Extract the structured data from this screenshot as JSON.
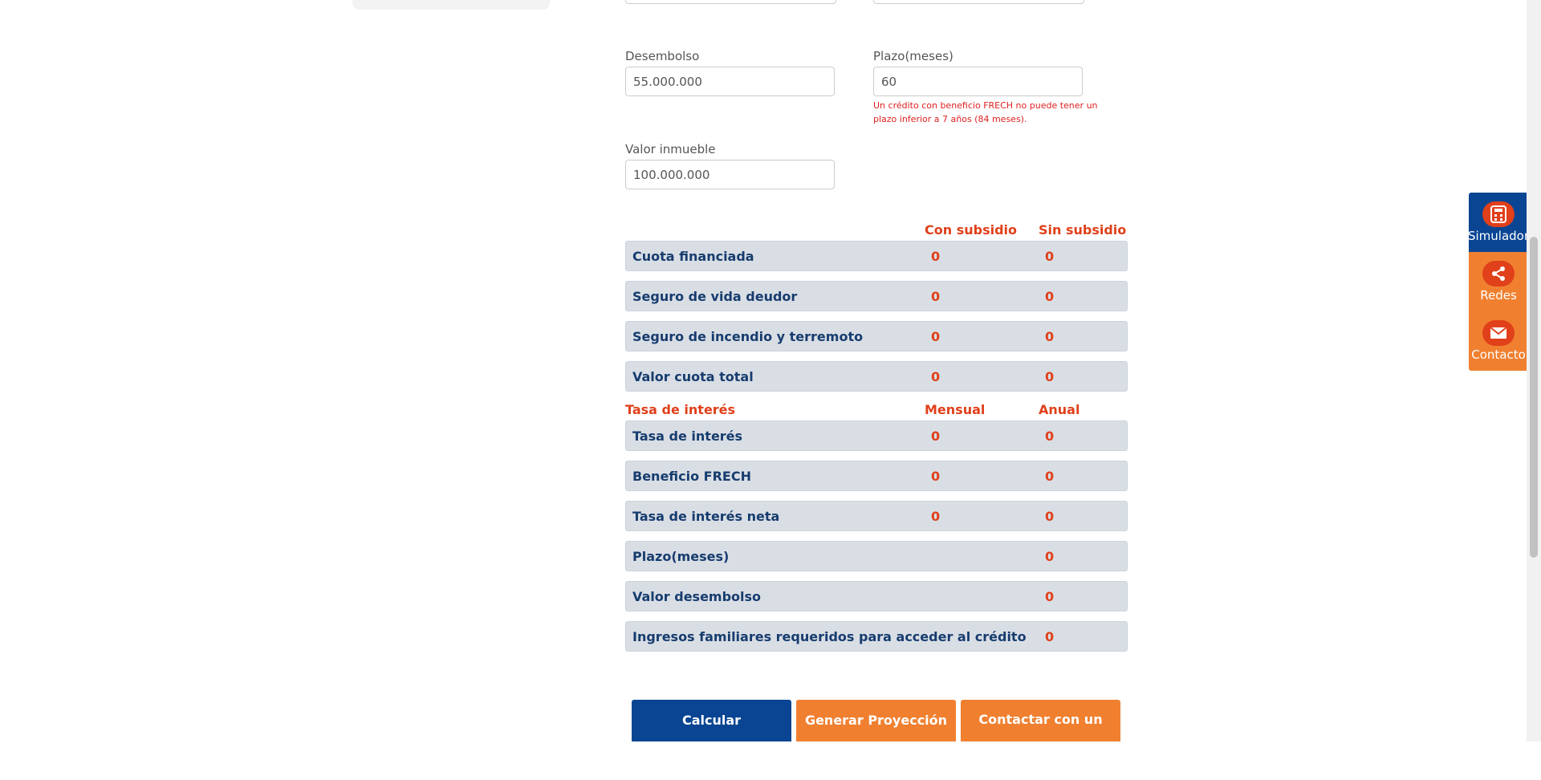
{
  "form": {
    "desembolso_label": "Desembolso",
    "desembolso_value": "55.000.000",
    "plazo_label": "Plazo(meses)",
    "plazo_value": "60",
    "plazo_error": "Un crédito con beneficio FRECH no puede tener un plazo inferior a 7 años (84 meses).",
    "valor_inmueble_label": "Valor inmueble",
    "valor_inmueble_value": "100.000.000"
  },
  "cuota_table": {
    "col1_header": "Con subsidio",
    "col2_header": "Sin subsidio",
    "rows": [
      {
        "label": "Cuota financiada",
        "v1": "0",
        "v2": "0"
      },
      {
        "label": "Seguro de vida deudor",
        "v1": "0",
        "v2": "0"
      },
      {
        "label": "Seguro de incendio y terremoto",
        "v1": "0",
        "v2": "0"
      },
      {
        "label": "Valor cuota total",
        "v1": "0",
        "v2": "0"
      }
    ]
  },
  "tasa_table": {
    "section_title": "Tasa de interés",
    "col1_header": "Mensual",
    "col2_header": "Anual",
    "rows": [
      {
        "label": "Tasa de interés",
        "v1": "0",
        "v2": "0"
      },
      {
        "label": "Beneficio FRECH",
        "v1": "0",
        "v2": "0"
      },
      {
        "label": "Tasa de interés neta",
        "v1": "0",
        "v2": "0"
      },
      {
        "label": "Plazo(meses)",
        "v2": "0"
      },
      {
        "label": "Valor desembolso",
        "v2": "0"
      },
      {
        "label": "Ingresos familiares requeridos para acceder al crédito",
        "v2": "0"
      }
    ]
  },
  "buttons": {
    "calcular": "Calcular",
    "proyeccion": "Generar Proyección",
    "asesor": "Contactar con un asesor"
  },
  "floating_menu": {
    "simulador": "Simulador",
    "redes": "Redes",
    "contacto": "Contacto"
  },
  "colors": {
    "primary_blue": "#0a4593",
    "accent_orange": "#f08030",
    "value_red": "#e0401a",
    "label_navy": "#173c6e",
    "row_bg": "#d9dee5"
  },
  "icons": {
    "simulador": "calculator-icon",
    "redes": "share-icon",
    "contacto": "mail-icon"
  }
}
